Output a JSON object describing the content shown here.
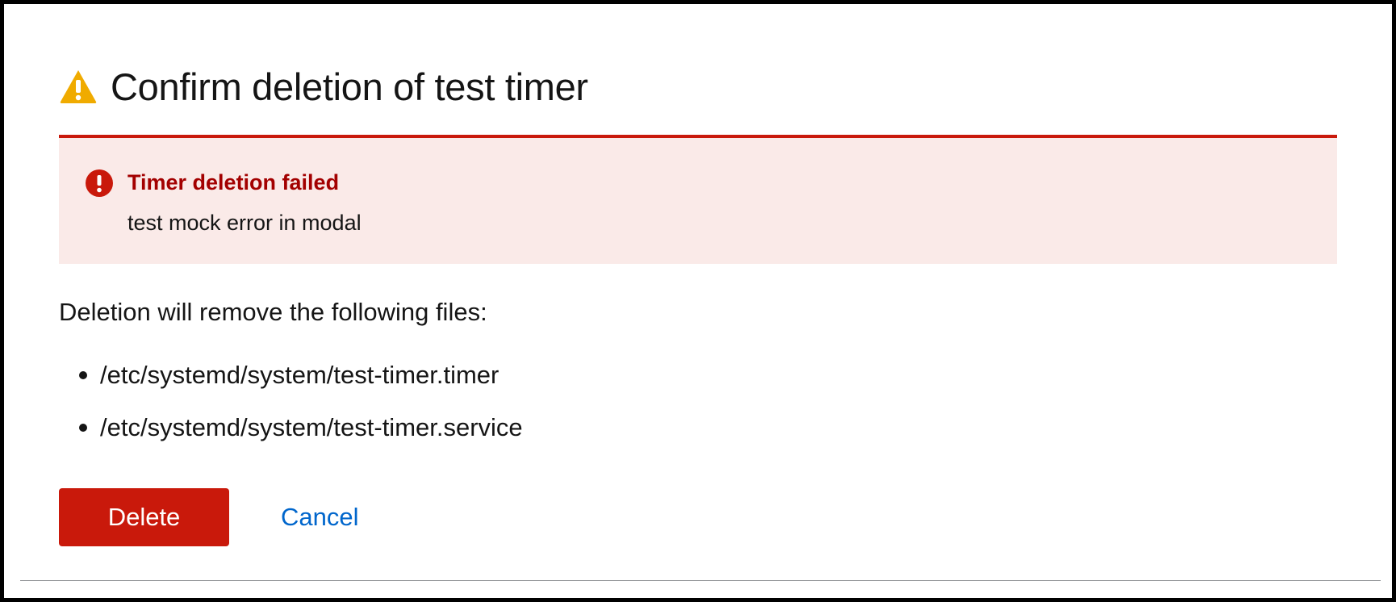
{
  "modal": {
    "title": "Confirm deletion of test timer",
    "title_icon": "warning-triangle-icon",
    "alert": {
      "icon": "error-circle-icon",
      "title": "Timer deletion failed",
      "message": "test mock error in modal"
    },
    "intro_text": "Deletion will remove the following files:",
    "files": [
      "/etc/systemd/system/test-timer.timer",
      "/etc/systemd/system/test-timer.service"
    ],
    "actions": {
      "delete_label": "Delete",
      "cancel_label": "Cancel"
    }
  },
  "colors": {
    "danger": "#c9190b",
    "danger_text": "#a30000",
    "alert_background": "#faeae8",
    "warning": "#f0ab00",
    "link": "#0066cc",
    "text": "#151515"
  }
}
